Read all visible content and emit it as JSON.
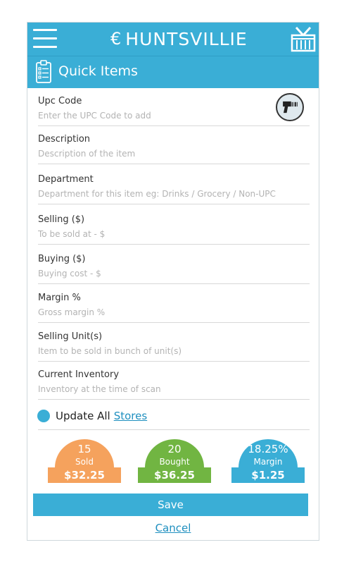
{
  "app": {
    "brand": "HUNTSVILLIE",
    "brand_color": "#3aaed6",
    "icons": [
      "menu-icon",
      "logo-icon",
      "basket-icon",
      "checklist-icon",
      "barcode-scanner-icon"
    ]
  },
  "header": {
    "title": "Quick Items"
  },
  "form": {
    "upc": {
      "label": "Upc Code",
      "placeholder": "Enter the UPC Code to add"
    },
    "description": {
      "label": "Description",
      "placeholder": "Description of the item"
    },
    "department": {
      "label": "Department",
      "placeholder": "Department for this item eg: Drinks / Grocery / Non-UPC"
    },
    "selling": {
      "label": "Selling ($)",
      "placeholder": "To be sold at - $"
    },
    "buying": {
      "label": "Buying ($)",
      "placeholder": "Buying cost - $"
    },
    "margin": {
      "label": "Margin %",
      "placeholder": "Gross margin %"
    },
    "unit": {
      "label": "Selling Unit(s)",
      "placeholder": "Item to be sold in bunch of unit(s)"
    },
    "inventory": {
      "label": "Current Inventory",
      "placeholder": "Inventory at the time of scan"
    }
  },
  "update": {
    "label": "Update All",
    "link": "Stores"
  },
  "stats": {
    "sold": {
      "value": "15",
      "label": "Sold",
      "amount": "$32.25",
      "color": "#f5a25d"
    },
    "bought": {
      "value": "20",
      "label": "Bought",
      "amount": "$36.25",
      "color": "#71b542"
    },
    "margin": {
      "value": "18.25%",
      "label": "Margin",
      "amount": "$1.25",
      "color": "#3aaed6"
    }
  },
  "actions": {
    "save": "Save",
    "cancel": "Cancel"
  }
}
